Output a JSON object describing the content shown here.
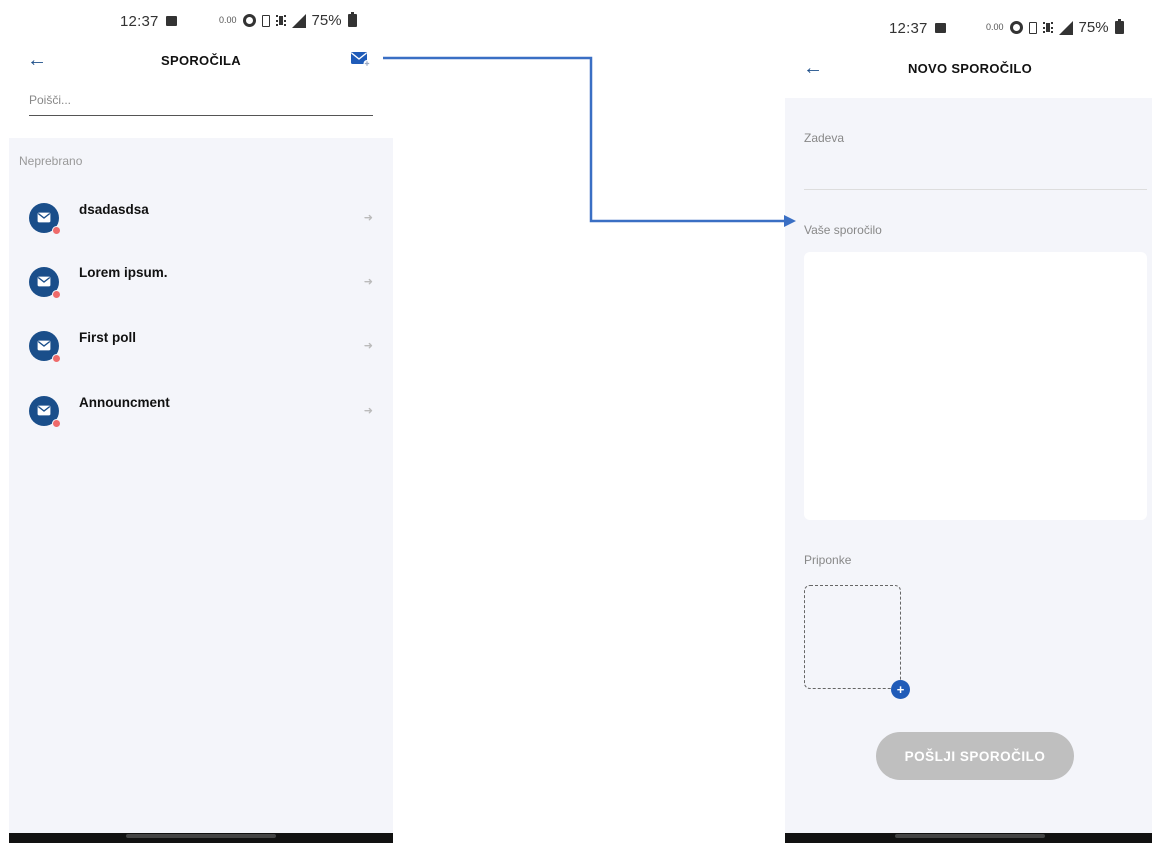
{
  "status_bar": {
    "time": "12:37",
    "data_speed": "0.00",
    "battery": "75%"
  },
  "inbox": {
    "title": "SPOROČILA",
    "search_placeholder": "Poišči...",
    "section_label": "Neprebrano",
    "messages": [
      {
        "title": "dsadasdsa",
        "unread": true
      },
      {
        "title": "Lorem ipsum.",
        "unread": true
      },
      {
        "title": "First poll",
        "unread": true
      },
      {
        "title": "Announcment",
        "unread": true
      }
    ]
  },
  "compose": {
    "title": "NOVO SPOROČILO",
    "subject_label": "Zadeva",
    "message_label": "Vaše sporočilo",
    "attachments_label": "Priponke",
    "send_label": "POŠLJI SPOROČILO"
  },
  "colors": {
    "primary": "#1a4e8a",
    "accent": "#1f5bb8",
    "connector": "#3a6fc4",
    "unread_dot": "#ef6b6b",
    "panel_bg": "#f4f5fa",
    "disabled_button": "#bfbfbf"
  },
  "icons": {
    "back": "arrow-left-icon",
    "compose": "envelope-plus-icon",
    "message": "envelope-icon",
    "chevron": "arrow-right-icon",
    "attach": "plus-icon"
  }
}
